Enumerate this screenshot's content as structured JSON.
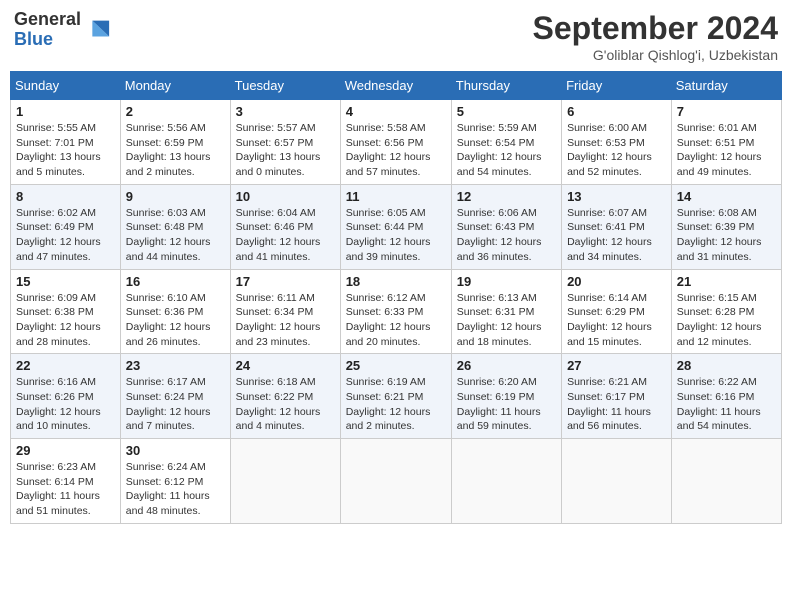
{
  "logo": {
    "line1": "General",
    "line2": "Blue"
  },
  "header": {
    "month": "September 2024",
    "location": "G'oliblar Qishlog'i, Uzbekistan"
  },
  "weekdays": [
    "Sunday",
    "Monday",
    "Tuesday",
    "Wednesday",
    "Thursday",
    "Friday",
    "Saturday"
  ],
  "weeks": [
    [
      {
        "day": "1",
        "sunrise": "5:55 AM",
        "sunset": "7:01 PM",
        "daylight": "13 hours and 5 minutes."
      },
      {
        "day": "2",
        "sunrise": "5:56 AM",
        "sunset": "6:59 PM",
        "daylight": "13 hours and 2 minutes."
      },
      {
        "day": "3",
        "sunrise": "5:57 AM",
        "sunset": "6:57 PM",
        "daylight": "13 hours and 0 minutes."
      },
      {
        "day": "4",
        "sunrise": "5:58 AM",
        "sunset": "6:56 PM",
        "daylight": "12 hours and 57 minutes."
      },
      {
        "day": "5",
        "sunrise": "5:59 AM",
        "sunset": "6:54 PM",
        "daylight": "12 hours and 54 minutes."
      },
      {
        "day": "6",
        "sunrise": "6:00 AM",
        "sunset": "6:53 PM",
        "daylight": "12 hours and 52 minutes."
      },
      {
        "day": "7",
        "sunrise": "6:01 AM",
        "sunset": "6:51 PM",
        "daylight": "12 hours and 49 minutes."
      }
    ],
    [
      {
        "day": "8",
        "sunrise": "6:02 AM",
        "sunset": "6:49 PM",
        "daylight": "12 hours and 47 minutes."
      },
      {
        "day": "9",
        "sunrise": "6:03 AM",
        "sunset": "6:48 PM",
        "daylight": "12 hours and 44 minutes."
      },
      {
        "day": "10",
        "sunrise": "6:04 AM",
        "sunset": "6:46 PM",
        "daylight": "12 hours and 41 minutes."
      },
      {
        "day": "11",
        "sunrise": "6:05 AM",
        "sunset": "6:44 PM",
        "daylight": "12 hours and 39 minutes."
      },
      {
        "day": "12",
        "sunrise": "6:06 AM",
        "sunset": "6:43 PM",
        "daylight": "12 hours and 36 minutes."
      },
      {
        "day": "13",
        "sunrise": "6:07 AM",
        "sunset": "6:41 PM",
        "daylight": "12 hours and 34 minutes."
      },
      {
        "day": "14",
        "sunrise": "6:08 AM",
        "sunset": "6:39 PM",
        "daylight": "12 hours and 31 minutes."
      }
    ],
    [
      {
        "day": "15",
        "sunrise": "6:09 AM",
        "sunset": "6:38 PM",
        "daylight": "12 hours and 28 minutes."
      },
      {
        "day": "16",
        "sunrise": "6:10 AM",
        "sunset": "6:36 PM",
        "daylight": "12 hours and 26 minutes."
      },
      {
        "day": "17",
        "sunrise": "6:11 AM",
        "sunset": "6:34 PM",
        "daylight": "12 hours and 23 minutes."
      },
      {
        "day": "18",
        "sunrise": "6:12 AM",
        "sunset": "6:33 PM",
        "daylight": "12 hours and 20 minutes."
      },
      {
        "day": "19",
        "sunrise": "6:13 AM",
        "sunset": "6:31 PM",
        "daylight": "12 hours and 18 minutes."
      },
      {
        "day": "20",
        "sunrise": "6:14 AM",
        "sunset": "6:29 PM",
        "daylight": "12 hours and 15 minutes."
      },
      {
        "day": "21",
        "sunrise": "6:15 AM",
        "sunset": "6:28 PM",
        "daylight": "12 hours and 12 minutes."
      }
    ],
    [
      {
        "day": "22",
        "sunrise": "6:16 AM",
        "sunset": "6:26 PM",
        "daylight": "12 hours and 10 minutes."
      },
      {
        "day": "23",
        "sunrise": "6:17 AM",
        "sunset": "6:24 PM",
        "daylight": "12 hours and 7 minutes."
      },
      {
        "day": "24",
        "sunrise": "6:18 AM",
        "sunset": "6:22 PM",
        "daylight": "12 hours and 4 minutes."
      },
      {
        "day": "25",
        "sunrise": "6:19 AM",
        "sunset": "6:21 PM",
        "daylight": "12 hours and 2 minutes."
      },
      {
        "day": "26",
        "sunrise": "6:20 AM",
        "sunset": "6:19 PM",
        "daylight": "11 hours and 59 minutes."
      },
      {
        "day": "27",
        "sunrise": "6:21 AM",
        "sunset": "6:17 PM",
        "daylight": "11 hours and 56 minutes."
      },
      {
        "day": "28",
        "sunrise": "6:22 AM",
        "sunset": "6:16 PM",
        "daylight": "11 hours and 54 minutes."
      }
    ],
    [
      {
        "day": "29",
        "sunrise": "6:23 AM",
        "sunset": "6:14 PM",
        "daylight": "11 hours and 51 minutes."
      },
      {
        "day": "30",
        "sunrise": "6:24 AM",
        "sunset": "6:12 PM",
        "daylight": "11 hours and 48 minutes."
      },
      null,
      null,
      null,
      null,
      null
    ]
  ]
}
